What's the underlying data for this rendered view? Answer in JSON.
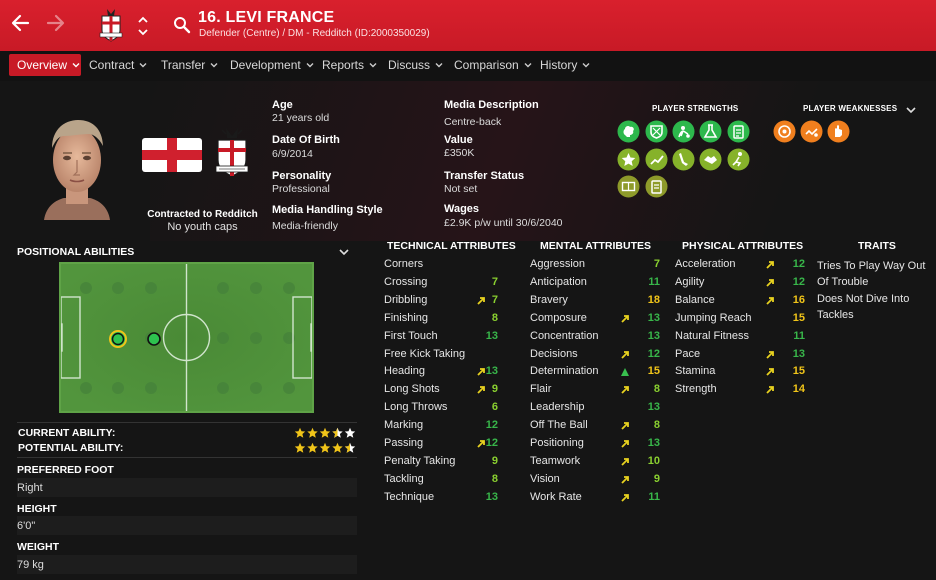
{
  "header": {
    "player_name": "16. LEVI FRANCE",
    "subtitle": "Defender (Centre) / DM - Redditch (ID:2000350029)",
    "back_icon": "arrow-left-icon",
    "forward_icon": "arrow-right-icon",
    "search_icon": "search-icon",
    "accent": "#c81a26"
  },
  "tabs": [
    {
      "label": "Overview",
      "active": true
    },
    {
      "label": "Contract",
      "active": false
    },
    {
      "label": "Transfer",
      "active": false
    },
    {
      "label": "Development",
      "active": false
    },
    {
      "label": "Reports",
      "active": false
    },
    {
      "label": "Discuss",
      "active": false
    },
    {
      "label": "Comparison",
      "active": false
    },
    {
      "label": "History",
      "active": false
    }
  ],
  "profile": {
    "contracted": "Contracted to Redditch",
    "youth_caps": "No youth caps"
  },
  "info": {
    "age_label": "Age",
    "age": "21 years old",
    "dob_label": "Date Of Birth",
    "dob": "6/9/2014",
    "personality_label": "Personality",
    "personality": "Professional",
    "media_style_label": "Media Handling Style",
    "media_style": "Media-friendly",
    "media_desc_label": "Media Description",
    "media_desc": "Centre-back",
    "value_label": "Value",
    "value": "£350K",
    "transfer_status_label": "Transfer Status",
    "transfer_status": "Not set",
    "wages_label": "Wages",
    "wages": "£2.9K p/w until 30/6/2040"
  },
  "strengths": {
    "title": "PLAYER STRENGTHS",
    "weak_title": "PLAYER WEAKNESSES"
  },
  "positional": {
    "title": "POSITIONAL ABILITIES",
    "current_ability_label": "CURRENT ABILITY:",
    "potential_ability_label": "POTENTIAL ABILITY:",
    "current_ability_stars": 3.5,
    "potential_ability_stars": 4.5
  },
  "side": {
    "foot_label": "PREFERRED FOOT",
    "foot": "Right",
    "height_label": "HEIGHT",
    "height": "6'0\"",
    "weight_label": "WEIGHT",
    "weight": "79 kg"
  },
  "technical": {
    "title": "TECHNICAL ATTRIBUTES",
    "rows": [
      {
        "name": "Corners",
        "value": "",
        "arrow": false
      },
      {
        "name": "Crossing",
        "value": "7",
        "arrow": false
      },
      {
        "name": "Dribbling",
        "value": "7",
        "arrow": true
      },
      {
        "name": "Finishing",
        "value": "8",
        "arrow": false
      },
      {
        "name": "First Touch",
        "value": "13",
        "arrow": false
      },
      {
        "name": "Free Kick Taking",
        "value": "",
        "arrow": false
      },
      {
        "name": "Heading",
        "value": "13",
        "arrow": true
      },
      {
        "name": "Long Shots",
        "value": "9",
        "arrow": true
      },
      {
        "name": "Long Throws",
        "value": "6",
        "arrow": false
      },
      {
        "name": "Marking",
        "value": "12",
        "arrow": false
      },
      {
        "name": "Passing",
        "value": "12",
        "arrow": true
      },
      {
        "name": "Penalty Taking",
        "value": "9",
        "arrow": false
      },
      {
        "name": "Tackling",
        "value": "8",
        "arrow": false
      },
      {
        "name": "Technique",
        "value": "13",
        "arrow": false
      }
    ]
  },
  "mental": {
    "title": "MENTAL ATTRIBUTES",
    "rows": [
      {
        "name": "Aggression",
        "value": "7",
        "arrow": false
      },
      {
        "name": "Anticipation",
        "value": "11",
        "arrow": false
      },
      {
        "name": "Bravery",
        "value": "18",
        "arrow": false
      },
      {
        "name": "Composure",
        "value": "13",
        "arrow": true
      },
      {
        "name": "Concentration",
        "value": "13",
        "arrow": false
      },
      {
        "name": "Decisions",
        "value": "12",
        "arrow": true
      },
      {
        "name": "Determination",
        "value": "15",
        "arrow": "up"
      },
      {
        "name": "Flair",
        "value": "8",
        "arrow": true
      },
      {
        "name": "Leadership",
        "value": "13",
        "arrow": false
      },
      {
        "name": "Off The Ball",
        "value": "8",
        "arrow": true
      },
      {
        "name": "Positioning",
        "value": "13",
        "arrow": true
      },
      {
        "name": "Teamwork",
        "value": "10",
        "arrow": true
      },
      {
        "name": "Vision",
        "value": "9",
        "arrow": true
      },
      {
        "name": "Work Rate",
        "value": "11",
        "arrow": true
      }
    ]
  },
  "physical": {
    "title": "PHYSICAL ATTRIBUTES",
    "rows": [
      {
        "name": "Acceleration",
        "value": "12",
        "arrow": true
      },
      {
        "name": "Agility",
        "value": "12",
        "arrow": true
      },
      {
        "name": "Balance",
        "value": "16",
        "arrow": true
      },
      {
        "name": "Jumping Reach",
        "value": "15",
        "arrow": false
      },
      {
        "name": "Natural Fitness",
        "value": "11",
        "arrow": false
      },
      {
        "name": "Pace",
        "value": "13",
        "arrow": true
      },
      {
        "name": "Stamina",
        "value": "15",
        "arrow": true
      },
      {
        "name": "Strength",
        "value": "14",
        "arrow": true
      }
    ]
  },
  "traits": {
    "title": "TRAITS",
    "items": [
      "Tries To Play Way Out Of Trouble",
      "Does Not Dive Into Tackles"
    ]
  }
}
